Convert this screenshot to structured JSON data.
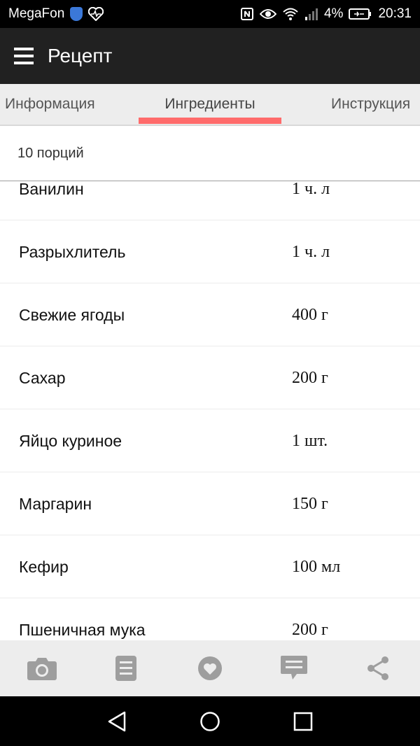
{
  "status_bar": {
    "carrier": "MegaFon",
    "battery_percent": "4%",
    "time": "20:31",
    "icons": [
      "shield-icon",
      "heartbeat-icon",
      "nfc-icon",
      "eye-icon",
      "wifi-icon",
      "signal-icon",
      "battery-icon"
    ]
  },
  "app_bar": {
    "title": "Рецепт",
    "menu_icon": "hamburger-menu-icon"
  },
  "tabs": [
    {
      "label": "Информация",
      "active": false
    },
    {
      "label": "Ингредиенты",
      "active": true
    },
    {
      "label": "Инструкция",
      "active": false
    }
  ],
  "servings": "10 порций",
  "ingredients": [
    {
      "name": "Ванилин",
      "qty": "1 ч. л"
    },
    {
      "name": "Разрыхлитель",
      "qty": "1 ч. л"
    },
    {
      "name": "Свежие ягоды",
      "qty": "400 г"
    },
    {
      "name": "Сахар",
      "qty": "200 г"
    },
    {
      "name": "Яйцо куриное",
      "qty": "1 шт."
    },
    {
      "name": "Маргарин",
      "qty": "150 г"
    },
    {
      "name": "Кефир",
      "qty": "100 мл"
    },
    {
      "name": "Пшеничная мука",
      "qty": "200 г"
    }
  ],
  "action_bar": [
    "camera-icon",
    "list-icon",
    "heart-icon",
    "comment-icon",
    "share-icon"
  ],
  "nav_bar": [
    "back-icon",
    "home-icon",
    "recents-icon"
  ],
  "colors": {
    "app_bar": "#212121",
    "tab_bg": "#ededed",
    "tab_indicator": "#ff6b6b",
    "action_icon": "#9e9e9e"
  }
}
